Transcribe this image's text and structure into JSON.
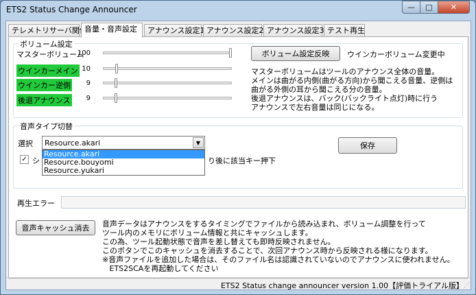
{
  "window": {
    "title": "ETS2 Status Change Announcer",
    "min_label": "—",
    "max_label": "□",
    "close_label": "✕"
  },
  "tabs": [
    {
      "label": "テレメトリサーバ関係"
    },
    {
      "label": "音量・音声設定"
    },
    {
      "label": "アナウンス設定1"
    },
    {
      "label": "アナウンス設定2"
    },
    {
      "label": "アナウンス設定3"
    },
    {
      "label": "テスト再生"
    }
  ],
  "active_tab": 1,
  "volume": {
    "title": "ボリューム設定",
    "master_label": "マスターボリューム",
    "master_value": "100",
    "blinker_main_label": "ウインカーメイン",
    "blinker_main_value": "10",
    "blinker_reverse_label": "ウインカー逆側",
    "blinker_reverse_value": "9",
    "reverse_announce_label": "後退アナウンス",
    "reverse_announce_value": "9",
    "apply_button": "ボリューム設定反映",
    "status": "ウインカーボリューム変更中",
    "description": "マスターボリュームはツールのアナウンス全体の音量。\nメインは曲がる内側(曲がる方向)から聞こえる音量、逆側は\n曲がる外側の耳から聞こえる分の音量。\n後退アナウンスは、バック(バックライト点灯)時に行う\nアナウンスで左右音量は同じになる。",
    "label_color": "#22c93b"
  },
  "voice": {
    "title": "音声タイプ切替",
    "select_label": "選択",
    "selected": "Resource.akari",
    "options": [
      "Resource.akari",
      "Resource.bouyomi",
      "Resource.yukari"
    ],
    "save_button": "保存",
    "checkbox_checked": true,
    "checkbox_label_prefix": "シ",
    "checkbox_label_suffix": "り後に該当キー押下"
  },
  "playback_error": {
    "label": "再生エラー",
    "value": ""
  },
  "cache": {
    "button": "音声キャッシュ消去",
    "description": "音声データはアナウンスをするタイミングでファイルから読み込まれ、ボリューム調整を行って\nツール内のメモリにボリューム情報と共にキャッシュします。\nこの為、ツール起動状態で音声を差し替えても即時反映されません。\nこのボタンでこのキャッシュを消去することで、次回アナウンス時から反映される様になります。\n※音声ファイルを追加した場合は、そのファイル名は認識されていないのでアナウンスに使われません。\n   ETS2SCAを再起動してください"
  },
  "statusbar": {
    "text": "ETS2 Status change announcer version 1.00【評価トライアル版】"
  },
  "sliders": {
    "master": 1.0,
    "blinker_main": 0.1,
    "blinker_reverse": 0.09,
    "reverse_announce": 0.09
  }
}
